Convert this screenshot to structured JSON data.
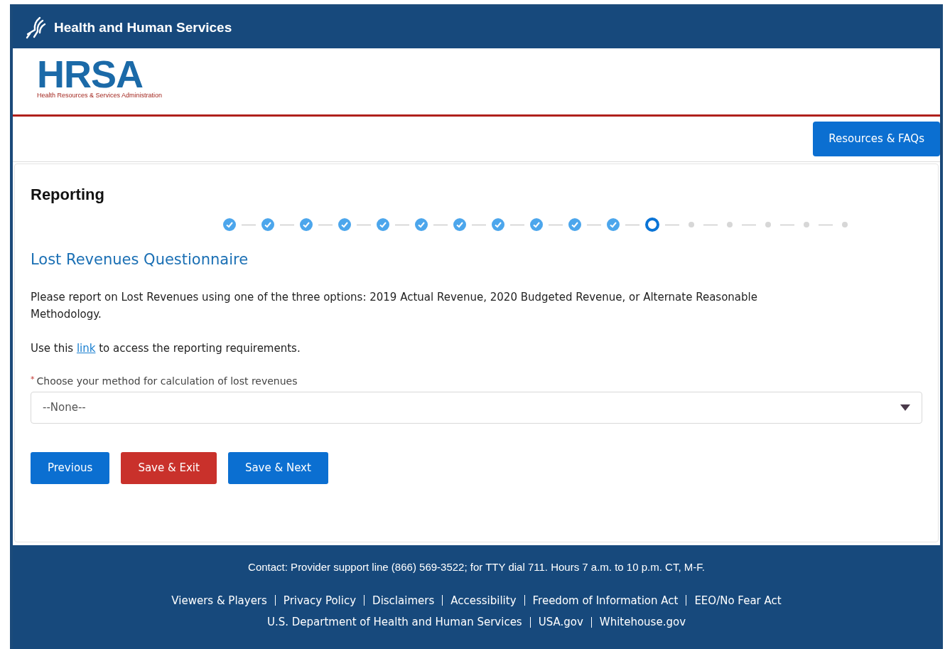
{
  "top_bar": {
    "title": "Health and Human Services"
  },
  "logo": {
    "acronym": "HRSA",
    "subtitle": "Health Resources & Services Administration"
  },
  "header_button": "Resources & FAQs",
  "page_title": "Reporting",
  "steps": [
    {
      "completed": true,
      "current": false
    },
    {
      "completed": true,
      "current": false
    },
    {
      "completed": true,
      "current": false
    },
    {
      "completed": true,
      "current": false
    },
    {
      "completed": true,
      "current": false
    },
    {
      "completed": true,
      "current": false
    },
    {
      "completed": true,
      "current": false
    },
    {
      "completed": true,
      "current": false
    },
    {
      "completed": true,
      "current": false
    },
    {
      "completed": true,
      "current": false
    },
    {
      "completed": true,
      "current": false
    },
    {
      "completed": false,
      "current": true
    },
    {
      "completed": false,
      "current": false
    },
    {
      "completed": false,
      "current": false
    },
    {
      "completed": false,
      "current": false
    },
    {
      "completed": false,
      "current": false
    },
    {
      "completed": false,
      "current": false
    }
  ],
  "section_title": "Lost Revenues Questionnaire",
  "intro": "Please report on Lost Revenues using one of the three options: 2019 Actual Revenue, 2020 Budgeted Revenue, or Alternate Reasonable Methodology.",
  "link_sentence": {
    "before": "Use this",
    "link": "link",
    "after": "to access the reporting requirements."
  },
  "method_field": {
    "required_mark": "*",
    "label": "Choose your method for calculation of lost revenues",
    "value": "--None--"
  },
  "buttons": [
    {
      "label": "Previous",
      "kind": "primary"
    },
    {
      "label": "Save & Exit",
      "kind": "danger"
    },
    {
      "label": "Save & Next",
      "kind": "primary"
    }
  ],
  "footer": {
    "contact": "Contact: Provider support line (866) 569-3522; for TTY dial 711. Hours 7 a.m. to 10 p.m. CT, M-F.",
    "links_row_1": [
      "Viewers & Players",
      "Privacy Policy",
      "Disclaimers",
      "Accessibility",
      "Freedom of Information Act",
      "EEO/No Fear Act"
    ],
    "links_row_2": [
      "U.S. Department of Health and Human Services",
      "USA.gov",
      "Whitehouse.gov"
    ]
  }
}
